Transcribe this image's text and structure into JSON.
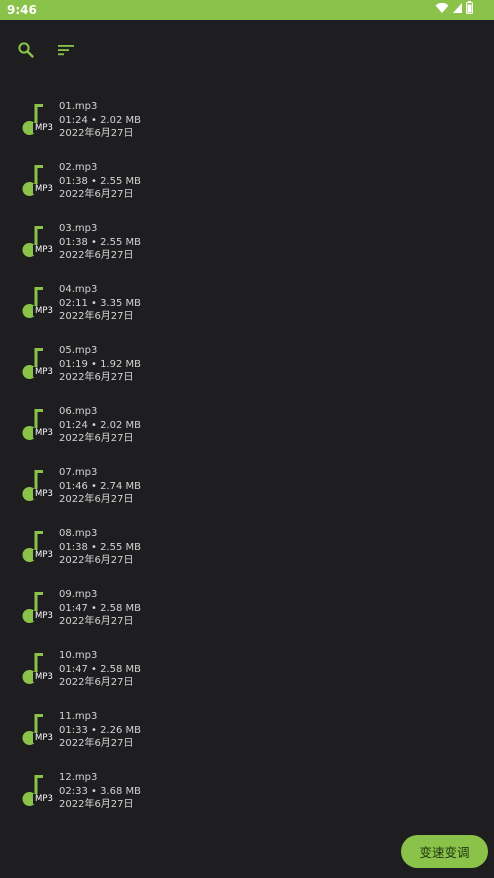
{
  "status_bar": {
    "time": "9:46",
    "bg_color": "#8bc34a",
    "icons": [
      "wifi-icon",
      "signal-icon",
      "battery-icon"
    ]
  },
  "toolbar": {
    "icons": [
      "search-icon",
      "sort-icon"
    ],
    "icon_color": "#8bc34a"
  },
  "file_icon": {
    "type_label": "MP3",
    "name": "music-note-icon",
    "color": "#8bc34a"
  },
  "files": [
    {
      "name": "01.mp3",
      "info": "01:24 • 2.02 MB",
      "date": "2022年6月27日"
    },
    {
      "name": "02.mp3",
      "info": "01:38 • 2.55 MB",
      "date": "2022年6月27日"
    },
    {
      "name": "03.mp3",
      "info": "01:38 • 2.55 MB",
      "date": "2022年6月27日"
    },
    {
      "name": "04.mp3",
      "info": "02:11 • 3.35 MB",
      "date": "2022年6月27日"
    },
    {
      "name": "05.mp3",
      "info": "01:19 • 1.92 MB",
      "date": "2022年6月27日"
    },
    {
      "name": "06.mp3",
      "info": "01:24 • 2.02 MB",
      "date": "2022年6月27日"
    },
    {
      "name": "07.mp3",
      "info": "01:46 • 2.74 MB",
      "date": "2022年6月27日"
    },
    {
      "name": "08.mp3",
      "info": "01:38 • 2.55 MB",
      "date": "2022年6月27日"
    },
    {
      "name": "09.mp3",
      "info": "01:47 • 2.58 MB",
      "date": "2022年6月27日"
    },
    {
      "name": "10.mp3",
      "info": "01:47 • 2.58 MB",
      "date": "2022年6月27日"
    },
    {
      "name": "11.mp3",
      "info": "01:33 • 2.26 MB",
      "date": "2022年6月27日"
    },
    {
      "name": "12.mp3",
      "info": "02:33 • 3.68 MB",
      "date": "2022年6月27日"
    }
  ],
  "fab": {
    "label": "变速变调",
    "color": "#8bc34a"
  }
}
